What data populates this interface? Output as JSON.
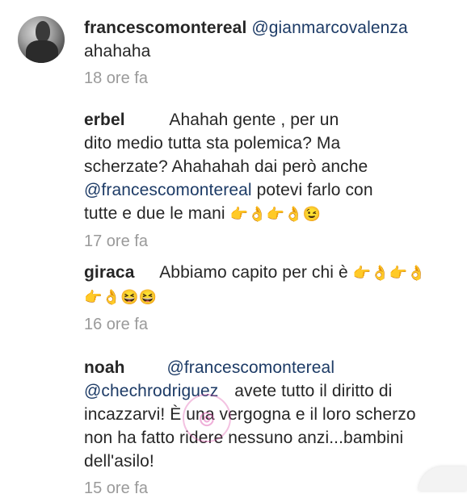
{
  "comments": [
    {
      "username": "francescomontereal",
      "mention": "@gianmarcovalenza",
      "text": "ahahaha",
      "time": "18 ore fa"
    },
    {
      "username": "erbel",
      "text_part1": "Ahahah gente , per un",
      "text_part2": "dito medio tutta sta polemica? Ma",
      "text_part3": "scherzate? Ahahahah dai però anche",
      "mention": "@francescomontereal",
      "text_part4": "potevi farlo con",
      "text_part5": "tutte e due le mani",
      "emojis": "👉👌👉👌😉",
      "time": "17 ore fa"
    },
    {
      "username": "giraca",
      "text": "Abbiamo capito per chi è",
      "emojis_line1": "👉👌👉👌",
      "emojis_line2": "👉👌😆😆",
      "time": "16 ore fa"
    },
    {
      "username": "noah",
      "mention1": "@francescomontereal",
      "mention2": "@chechrodriguez",
      "text_part1": "avete tutto il diritto di",
      "text_part2": "incazzarvi! È una vergogna e il loro scherzo",
      "text_part3": "non ha fatto ridere nessuno anzi...bambini",
      "text_part4": "dell'asilo!",
      "time": "15 ore fa"
    }
  ],
  "icons": {
    "avatar": "profile-avatar",
    "watermark": "watermark-logo"
  }
}
